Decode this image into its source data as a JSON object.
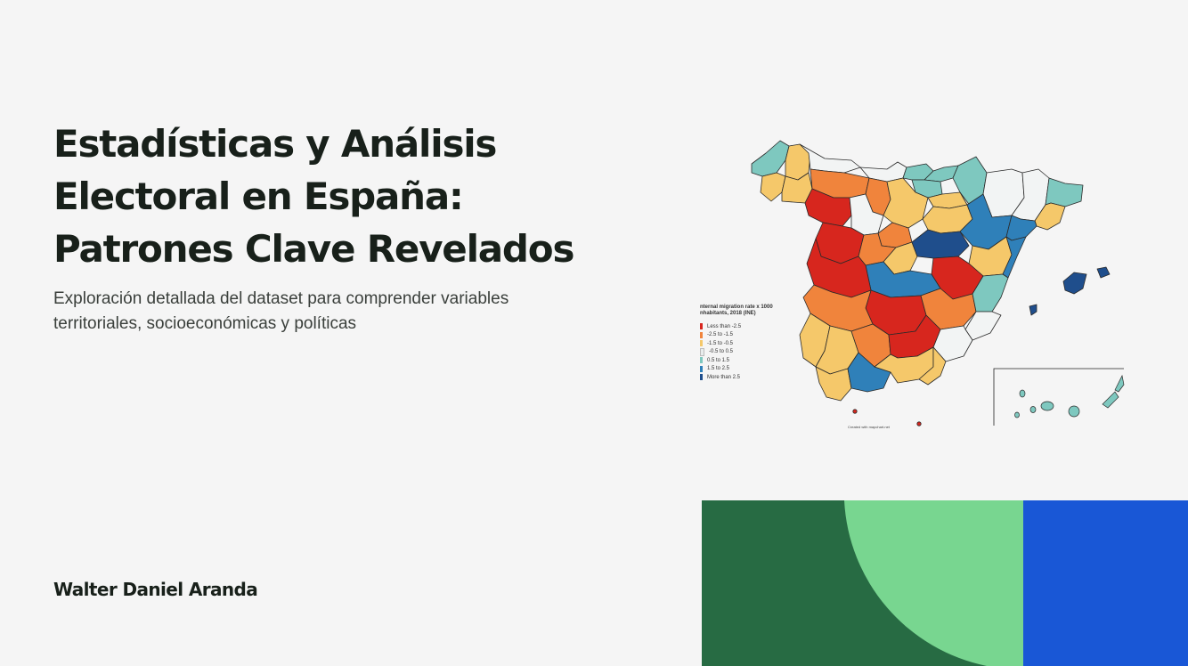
{
  "slide": {
    "title_lines": [
      "Estadísticas y Análisis",
      "Electoral en España:",
      "Patrones Clave Revelados"
    ],
    "subtitle_lines": [
      "Exploración detallada del dataset para comprender variables",
      "territoriales, socioeconómicas y políticas"
    ],
    "author": "Walter Daniel Aranda"
  },
  "map": {
    "legend_title_lines": [
      "nternal migration rate x 1000",
      "nhabitants, 2018 (INE)"
    ],
    "legend_items": [
      {
        "label": "Less than -2.5",
        "color": "#d7261e"
      },
      {
        "label": "-2.5 to -1.5",
        "color": "#f0843c"
      },
      {
        "label": "-1.5 to -0.5",
        "color": "#f5c86a"
      },
      {
        "label": "-0.5 to 0.5",
        "color": "#f2f4f4"
      },
      {
        "label": "0.5 to 1.5",
        "color": "#7ec8bf"
      },
      {
        "label": "1.5 to 2.5",
        "color": "#2f80b9"
      },
      {
        "label": "More than 2.5",
        "color": "#1f4e8c"
      }
    ],
    "credit": "Created with mapchart.net"
  },
  "colors": {
    "background": "#f5f5f5",
    "deco_dark_green": "#276b43",
    "deco_light_green": "#78d690",
    "deco_blue": "#1957d6"
  }
}
